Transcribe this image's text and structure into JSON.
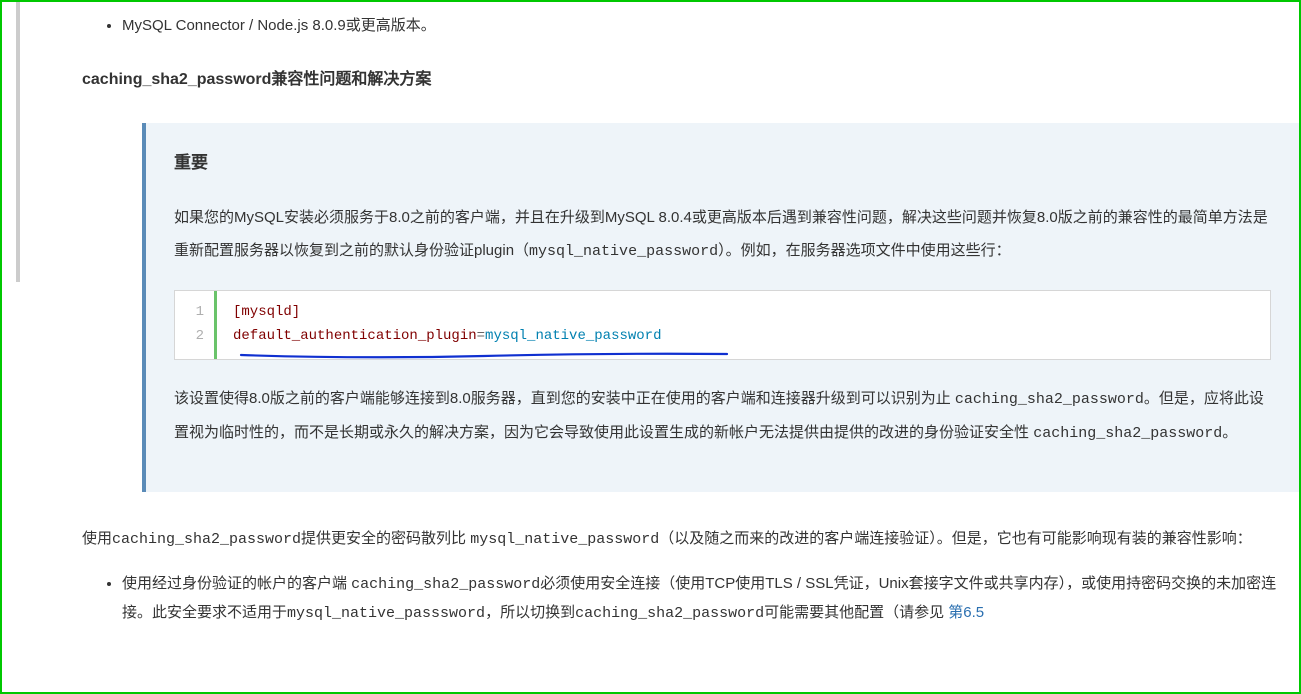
{
  "listItem1": "MySQL Connector / Node.js 8.0.9或更高版本。",
  "heading": "caching_sha2_password兼容性问题和解决方案",
  "note": {
    "title": "重要",
    "para1_a": "如果您的MySQL安装必须服务于8.0之前的客户端，并且在升级到MySQL 8.0.4或更高版本后遇到兼容性问题，解决这些问题并恢复8.0版之前的兼容性的最简单方法是重新配置服务器以恢复到之前的默认身份验证plugin（",
    "para1_code": "mysql_native_password",
    "para1_b": "）。例如，在服务器选项文件中使用这些行：",
    "code": {
      "ln1": "1",
      "ln2": "2",
      "line1": "[mysqld]",
      "line2_key": "default_authentication_plugin",
      "line2_eq": "=",
      "line2_val": "mysql_native_password"
    },
    "para2_a": "该设置使得8.0版之前的客户端能够连接到8.0服务器，直到您的安装中正在使用的客户端和连接器升级到可以识别为止 ",
    "para2_code1": "caching_sha2_password",
    "para2_b": "。但是，应将此设置视为临时性的，而不是长期或永久的解决方案，因为它会导致使用此设置生成的新帐户无法提供由提供的改进的身份验证安全性 ",
    "para2_code2": "caching_sha2_password",
    "para2_c": "。"
  },
  "para_after_a": "使用",
  "para_after_code1": "caching_sha2_password",
  "para_after_b": "提供更安全的密码散列比 ",
  "para_after_code2": "mysql_native_password",
  "para_after_c": "（以及随之而来的改进的客户端连接验证）。但是，它也有可能影响现有装的兼容性影响：",
  "bullet2_a": "使用经过身份验证的帐户的客户端 ",
  "bullet2_code1": "caching_sha2_password",
  "bullet2_b": "必须使用安全连接（使用TCP使用TLS / SSL凭证，Unix套接字文件或共享内存），或使用持密码交换的未加密连接。此安全要求不适用于",
  "bullet2_code2": "mysql_native_passsword",
  "bullet2_c": "，所以切换到",
  "bullet2_code3": "caching_sha2_password",
  "bullet2_d": "可能需要其他配置（请参见 ",
  "bullet2_link": "第6.5"
}
